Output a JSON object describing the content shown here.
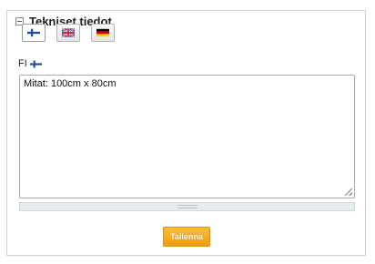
{
  "panel": {
    "title": "Tekniset tiedot",
    "collapse_icon": "minus-box-icon"
  },
  "languages": [
    {
      "code": "fi",
      "flag": "finland-flag-icon",
      "active": true
    },
    {
      "code": "en",
      "flag": "uk-flag-icon",
      "active": false
    },
    {
      "code": "de",
      "flag": "germany-flag-icon",
      "active": false
    }
  ],
  "editor": {
    "language_label": "FI",
    "language_flag": "finland-flag-icon",
    "value": "Mitat: 100cm x 80cm"
  },
  "actions": {
    "save_label": "Tallenna"
  },
  "colors": {
    "save_button": "#f5a623",
    "panel_border": "#d0d0d0",
    "splitter": "#e6ebed"
  }
}
